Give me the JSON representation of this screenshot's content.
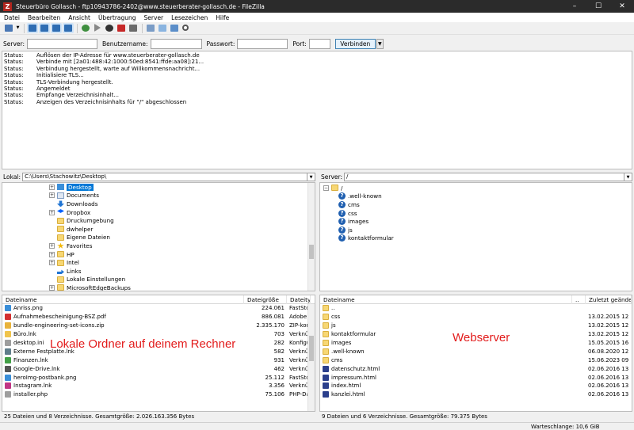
{
  "window": {
    "title": "Steuerbüro Gollasch - ftp10943786-2402@www.steuerberater-gollasch.de - FileZilla",
    "app_icon_letter": "Z",
    "minimize": "–",
    "maximize": "☐",
    "close": "✕"
  },
  "menu": [
    "Datei",
    "Bearbeiten",
    "Ansicht",
    "Übertragung",
    "Server",
    "Lesezeichen",
    "Hilfe"
  ],
  "quickconnect": {
    "server_label": "Server:",
    "user_label": "Benutzername:",
    "password_label": "Passwort:",
    "port_label": "Port:",
    "server_value": "",
    "user_value": "",
    "password_value": "",
    "port_value": "",
    "connect_label": "Verbinden",
    "dropdown_glyph": "▼"
  },
  "log": [
    {
      "status": "Status:",
      "text": "Auflösen der IP-Adresse für www.steuerberater-gollasch.de"
    },
    {
      "status": "Status:",
      "text": "Verbinde mit [2a01:488:42:1000:50ed:8541:ffde:aa08]:21..."
    },
    {
      "status": "Status:",
      "text": "Verbindung hergestellt, warte auf Willkommensnachricht..."
    },
    {
      "status": "Status:",
      "text": "Initialisiere TLS..."
    },
    {
      "status": "Status:",
      "text": "TLS-Verbindung hergestellt."
    },
    {
      "status": "Status:",
      "text": "Angemeldet"
    },
    {
      "status": "Status:",
      "text": "Empfange Verzeichnisinhalt..."
    },
    {
      "status": "Status:",
      "text": "Anzeigen des Verzeichnisinhalts für \"/\" abgeschlossen"
    }
  ],
  "local": {
    "label": "Lokal:",
    "path": "C:\\Users\\Stachowitz\\Desktop\\",
    "tree": [
      {
        "label": "Desktop",
        "icon": "desktop-folder",
        "expander": "+",
        "selected": true
      },
      {
        "label": "Documents",
        "icon": "documents-folder",
        "expander": "+"
      },
      {
        "label": "Downloads",
        "icon": "download-arrow",
        "expander": ""
      },
      {
        "label": "Dropbox",
        "icon": "dropbox",
        "expander": "+"
      },
      {
        "label": "Druckumgebung",
        "icon": "folder",
        "expander": ""
      },
      {
        "label": "dwhelper",
        "icon": "folder",
        "expander": ""
      },
      {
        "label": "Eigene Dateien",
        "icon": "folder",
        "expander": ""
      },
      {
        "label": "Favorites",
        "icon": "star",
        "expander": "+"
      },
      {
        "label": "HP",
        "icon": "folder",
        "expander": "+"
      },
      {
        "label": "Intel",
        "icon": "folder",
        "expander": "+"
      },
      {
        "label": "Links",
        "icon": "link-arrow",
        "expander": ""
      },
      {
        "label": "Lokale Einstellungen",
        "icon": "folder",
        "expander": ""
      },
      {
        "label": "MicrosoftEdgeBackups",
        "icon": "folder",
        "expander": "+"
      }
    ],
    "columns": {
      "name": "Dateiname",
      "size": "Dateigröße",
      "type": "Dateityp"
    },
    "files": [
      {
        "name": "Anriss.png",
        "size": "224.061",
        "type": "FastStone Pl",
        "color": "#3a8ed8"
      },
      {
        "name": "Aufnahmebescheinigung-BSZ.pdf",
        "size": "886.081",
        "type": "Adobe Acro",
        "color": "#d32f2f"
      },
      {
        "name": "bundle-engineering-set-icons.zip",
        "size": "2.335.170",
        "type": "ZIP-komprir",
        "color": "#e8b23a"
      },
      {
        "name": "Büro.lnk",
        "size": "703",
        "type": "Verknüpfung",
        "color": "#f0c44c"
      },
      {
        "name": "desktop.ini",
        "size": "282",
        "type": "Konfiguratic",
        "color": "#9e9e9e"
      },
      {
        "name": "Externe Festplatte.lnk",
        "size": "582",
        "type": "Verknüpfunc",
        "color": "#607d8b"
      },
      {
        "name": "Finanzen.lnk",
        "size": "931",
        "type": "Verknüpfunc",
        "color": "#43a047"
      },
      {
        "name": "Google-Drive.lnk",
        "size": "462",
        "type": "Verknüpfunc",
        "color": "#555555"
      },
      {
        "name": "heroImg-postbank.png",
        "size": "25.112",
        "type": "FastStone Pl",
        "color": "#3a8ed8"
      },
      {
        "name": "Instagram.lnk",
        "size": "3.356",
        "type": "Verknüpfunc",
        "color": "#c13584"
      },
      {
        "name": "installer.php",
        "size": "75.106",
        "type": "PHP-Datei",
        "color": "#9e9e9e"
      }
    ],
    "annotation": "Lokale Ordner auf deinem Rechner",
    "status": "25 Dateien und 8 Verzeichnisse. Gesamtgröße: 2.026.163.356 Bytes"
  },
  "remote": {
    "label": "Server:",
    "path": "/",
    "tree_root": "/",
    "tree": [
      ".well-known",
      "cms",
      "css",
      "images",
      "js",
      "kontaktformular"
    ],
    "columns": {
      "name": "Dateiname",
      "dots": "..",
      "changed": "Zuletzt geände"
    },
    "files": [
      {
        "name": "..",
        "date": "",
        "kind": "folder"
      },
      {
        "name": "css",
        "date": "13.02.2015 12",
        "kind": "folder"
      },
      {
        "name": "js",
        "date": "13.02.2015 12",
        "kind": "folder"
      },
      {
        "name": "kontaktformular",
        "date": "13.02.2015 12",
        "kind": "folder"
      },
      {
        "name": "images",
        "date": "15.05.2015 16",
        "kind": "folder"
      },
      {
        "name": ".well-known",
        "date": "06.08.2020 12",
        "kind": "folder"
      },
      {
        "name": "cms",
        "date": "15.06.2023 09",
        "kind": "folder"
      },
      {
        "name": "datenschutz.html",
        "date": "02.06.2016 13",
        "kind": "html"
      },
      {
        "name": "impressum.html",
        "date": "02.06.2016 13",
        "kind": "html"
      },
      {
        "name": "index.html",
        "date": "02.06.2016 13",
        "kind": "html"
      },
      {
        "name": "kanzlei.html",
        "date": "02.06.2016 13",
        "kind": "html"
      }
    ],
    "annotation": "Webserver",
    "status": "9 Dateien und 6 Verzeichnisse. Gesamtgröße: 79.375 Bytes"
  },
  "queue": {
    "text": "Warteschlange: 10,6 GiB"
  },
  "colors": {
    "accent": "#0078d7",
    "annotation": "#e21b1b",
    "titlebar": "#2b2b2b"
  }
}
